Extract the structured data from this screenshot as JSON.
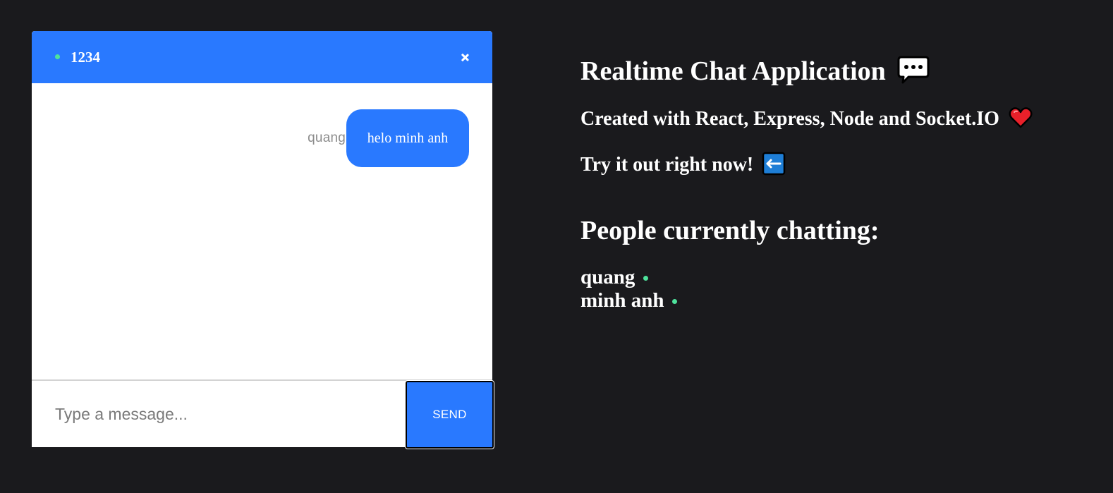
{
  "chat": {
    "room_name": "1234",
    "messages": [
      {
        "sender": "quang",
        "text": "helo minh anh"
      }
    ],
    "input_placeholder": "Type a message...",
    "send_label": "SEND"
  },
  "info": {
    "title": "Realtime Chat Application",
    "created_with": "Created with React, Express, Node and Socket.IO",
    "try_it": "Try it out right now!",
    "people_heading": "People currently chatting:",
    "people": [
      "quang",
      "minh anh"
    ]
  },
  "icons": {
    "title_icon": "speech-bubble-icon",
    "created_icon": "heart-icon",
    "try_icon": "left-arrow-icon",
    "online_indicator": "online-dot-icon",
    "close": "close-icon"
  },
  "colors": {
    "background": "#1a1a1d",
    "accent": "#2979ff",
    "online": "#4ee39c",
    "sender_name": "#8c8c8c"
  }
}
